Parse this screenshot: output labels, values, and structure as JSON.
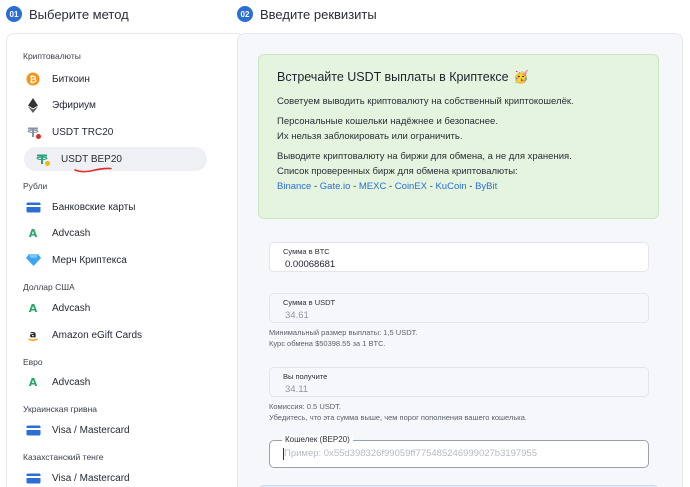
{
  "steps": {
    "step1": {
      "num": "01",
      "title": "Выберите метод"
    },
    "step2": {
      "num": "02",
      "title": "Введите реквизиты"
    }
  },
  "sidebar": {
    "groups": [
      {
        "label": "Криптовалюты"
      },
      {
        "label": "Рубли"
      },
      {
        "label": "Доллар США"
      },
      {
        "label": "Евро"
      },
      {
        "label": "Украинская гривна"
      },
      {
        "label": "Казахстанский тенге"
      }
    ],
    "items": [
      {
        "label": "Биткоин",
        "icon": "bitcoin-icon"
      },
      {
        "label": "Эфириум",
        "icon": "ethereum-icon"
      },
      {
        "label": "USDT TRC20",
        "icon": "tether-trc20-icon"
      },
      {
        "label": "USDT BEP20",
        "icon": "tether-bep20-icon",
        "active": true
      },
      {
        "label": "Банковские карты",
        "icon": "bank-card-icon"
      },
      {
        "label": "Advcash",
        "icon": "advcash-icon"
      },
      {
        "label": "Мерч Криптекса",
        "icon": "diamond-icon"
      },
      {
        "label": "Advcash",
        "icon": "advcash-icon"
      },
      {
        "label": "Amazon eGift Cards",
        "icon": "amazon-icon"
      },
      {
        "label": "Advcash",
        "icon": "advcash-icon"
      },
      {
        "label": "Visa / Mastercard",
        "icon": "bank-card-icon"
      },
      {
        "label": "Visa / Mastercard",
        "icon": "bank-card-icon"
      }
    ]
  },
  "info": {
    "title": "Встречайте USDT выплаты в Криптексе",
    "emoji": "🥳",
    "line1": "Советуем выводить криптовалюту на собственный криптокошелёк.",
    "line2": "Персональные кошельки надёжнее и безопаснее.",
    "line3": "Их нельзя заблокировать или ограничить.",
    "line4": "Выводите криптовалюту на биржи для обмена, а не для хранения.",
    "line5": "Список проверенных бирж для обмена криптовалюты:",
    "exchanges": [
      "Binance",
      "Gate.io",
      "MEXC",
      "CoinEX",
      "KuCoin",
      "ByBit"
    ],
    "separator": " - "
  },
  "form": {
    "btc": {
      "label": "Сумма в BTC",
      "value": "0.00068681"
    },
    "usdt": {
      "label": "Сумма в USDT",
      "value": "34.61"
    },
    "usdt_hint1": "Минимальный размер выплаты: 1,5 USDT.",
    "usdt_hint2": "Курс обмена $50398.55 за 1 BTC.",
    "receive": {
      "label": "Вы получите",
      "value": "34.11"
    },
    "receive_hint1": "Комиссия: 0.5 USDT.",
    "receive_hint2": "Убедитесь, что эта сумма выше, чем порог пополнения вашего кошелька.",
    "wallet": {
      "label": "Кошелек (BEP20)",
      "placeholder": "Пример: 0x55d398326f99059ff775485246999027b3197955",
      "value": ""
    }
  },
  "colors": {
    "accent": "#2b6fd6",
    "info_bg": "#e4f4df",
    "active_bg": "#eef0f4",
    "annotation": "#e02b2b"
  }
}
